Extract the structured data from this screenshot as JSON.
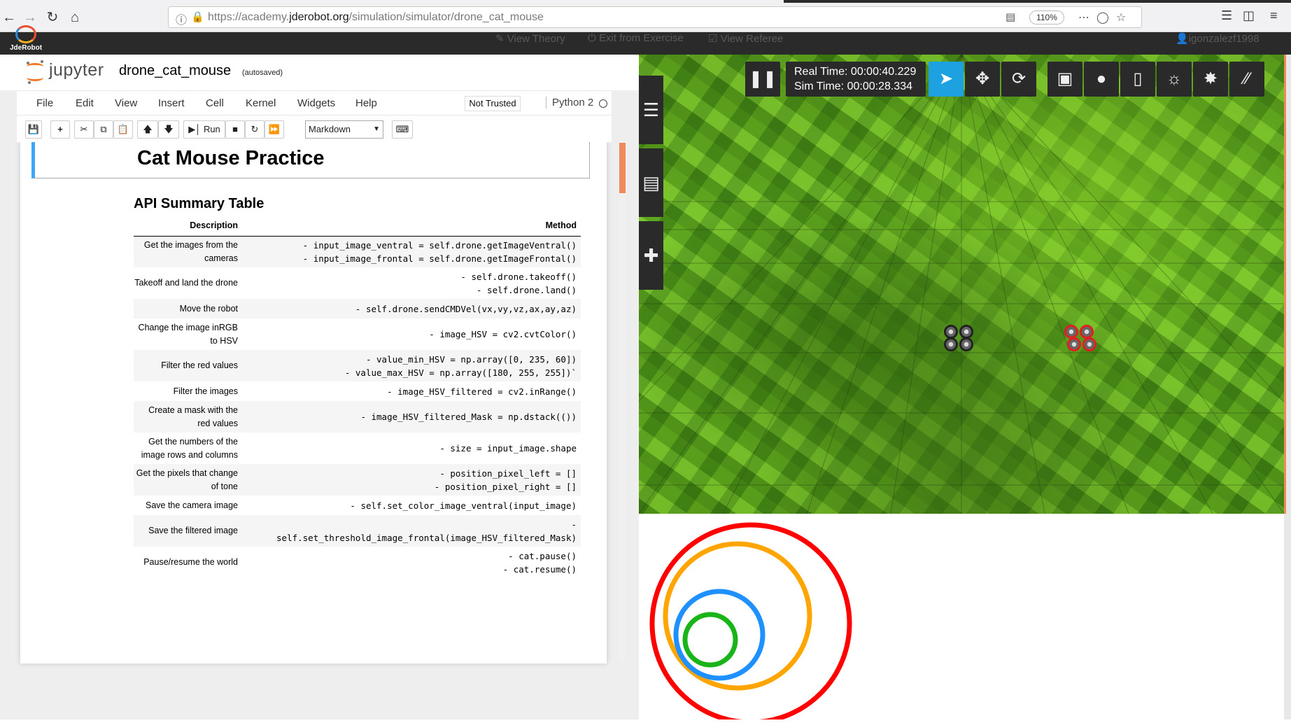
{
  "browser": {
    "url_prefix": "https://academy.",
    "url_domain": "jderobot.org",
    "url_suffix": "/simulation/simulator/drone_cat_mouse",
    "zoom": "110%",
    "back_icon": "arrow-left-icon",
    "forward_icon": "arrow-right-icon",
    "reload_icon": "reload-icon",
    "home_icon": "home-icon"
  },
  "site": {
    "logo_text": "JdeRobot",
    "menu": [
      "View Theory",
      "Exit from Exercise",
      "View Referee"
    ],
    "user": "igonzalezf1998"
  },
  "jupyter": {
    "brand": "jupyter",
    "notebook_name": "drone_cat_mouse",
    "autosave": "(autosaved)",
    "menu": [
      "File",
      "Edit",
      "View",
      "Insert",
      "Cell",
      "Kernel",
      "Widgets",
      "Help"
    ],
    "trusted": "Not Trusted",
    "kernel": "Python 2",
    "run_label": "Run",
    "cell_type": "Markdown",
    "heading": "Cat Mouse Practice",
    "api_title": "API Summary Table",
    "table": {
      "headers": [
        "Description",
        "Method"
      ],
      "rows": [
        {
          "desc": "Get the images from the cameras",
          "method": "- input_image_ventral = self.drone.getImageVentral()\n- input_image_frontal = self.drone.getImageFrontal()"
        },
        {
          "desc": "Takeoff and land the drone",
          "method": "- self.drone.takeoff()\n- self.drone.land()"
        },
        {
          "desc": "Move the robot",
          "method": "- self.drone.sendCMDVel(vx,vy,vz,ax,ay,az)"
        },
        {
          "desc": "Change the image inRGB to HSV",
          "method": "- image_HSV = cv2.cvtColor()"
        },
        {
          "desc": "Filter the red values",
          "method": "- value_min_HSV = np.array([0, 235, 60])\n- value_max_HSV = np.array([180, 255, 255])`"
        },
        {
          "desc": "Filter the images",
          "method": "- image_HSV_filtered = cv2.inRange()"
        },
        {
          "desc": "Create a mask with the red values",
          "method": "- image_HSV_filtered_Mask = np.dstack(())"
        },
        {
          "desc": "Get the numbers of the image rows and columns",
          "method": "- size = input_image.shape"
        },
        {
          "desc": "Get the pixels that change of tone",
          "method": "- position_pixel_left = []\n- position_pixel_right  = []"
        },
        {
          "desc": "Save the camera image",
          "method": "- self.set_color_image_ventral(input_image)"
        },
        {
          "desc": "Save the filtered image",
          "method": "-\nself.set_threshold_image_frontal(image_HSV_filtered_Mask)"
        },
        {
          "desc": "Pause/resume the world",
          "method": "- cat.pause()\n- cat.resume()"
        }
      ]
    }
  },
  "simulator": {
    "real_time_label": "Real Time:",
    "real_time": "00:00:40.229",
    "sim_time_label": "Sim Time:",
    "sim_time": "00:00:28.334",
    "tools": [
      "pause-icon",
      "select-arrow-icon",
      "translate-icon",
      "rotate-icon",
      "box-icon",
      "sphere-icon",
      "cylinder-icon",
      "sun-icon",
      "spotlight-icon",
      "directional-light-icon"
    ],
    "side_tabs": [
      "menu-icon",
      "layers-icon",
      "plus-icon"
    ]
  },
  "colors": {
    "accent": "#f08a5d",
    "jupyter_orange": "#f37726",
    "selected_cell": "#42a5f5",
    "sim_active_tool": "#1da1e0",
    "circle_red": "#ff0000",
    "circle_orange": "#ffa500",
    "circle_blue": "#1e90ff",
    "circle_green": "#18b418"
  }
}
